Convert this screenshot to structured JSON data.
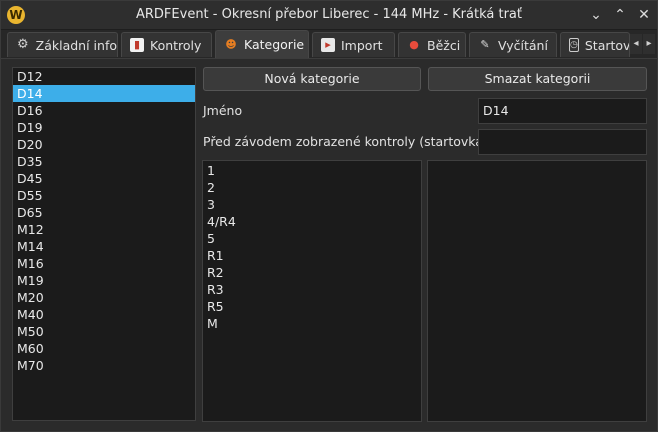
{
  "window": {
    "title": "ARDFEvent - Okresní přebor Liberec - 144 MHz - Krátká trať",
    "app_icon_letter": "W",
    "buttons": {
      "minimize": "⌄",
      "maximize": "⌃",
      "close": "✕"
    }
  },
  "tabs": [
    {
      "label": "Základní info",
      "icon": "gear-icon",
      "active": false
    },
    {
      "label": "Kontroly",
      "icon": "flag-icon",
      "active": false
    },
    {
      "label": "Kategorie",
      "icon": "people-icon",
      "active": true
    },
    {
      "label": "Import",
      "icon": "import-icon",
      "active": false
    },
    {
      "label": "Běžci",
      "icon": "runner-icon",
      "active": false
    },
    {
      "label": "Vyčítání",
      "icon": "reader-icon",
      "active": false
    },
    {
      "label": "Startov",
      "icon": "clock-icon",
      "active": false
    }
  ],
  "tab_scroll": {
    "left": "◂",
    "right": "▸"
  },
  "categories": {
    "items": [
      "D12",
      "D14",
      "D16",
      "D19",
      "D20",
      "D35",
      "D45",
      "D55",
      "D65",
      "M12",
      "M14",
      "M16",
      "M19",
      "M20",
      "M40",
      "M50",
      "M60",
      "M70"
    ],
    "selected": "D14"
  },
  "actions": {
    "new_category": "Nová kategorie",
    "delete_category": "Smazat kategorii"
  },
  "form": {
    "name_label": "Jméno",
    "name_value": "D14",
    "visible_controls_label": "Před závodem zobrazené kontroly (startovka, ...)",
    "visible_controls_value": ""
  },
  "controls": {
    "items": [
      "1",
      "2",
      "3",
      "4/R4",
      "5",
      "R1",
      "R2",
      "R3",
      "R5",
      "M"
    ]
  },
  "colors": {
    "selection": "#3daee9",
    "background": "#2b2b2b",
    "list_background": "#1b1b1b"
  }
}
